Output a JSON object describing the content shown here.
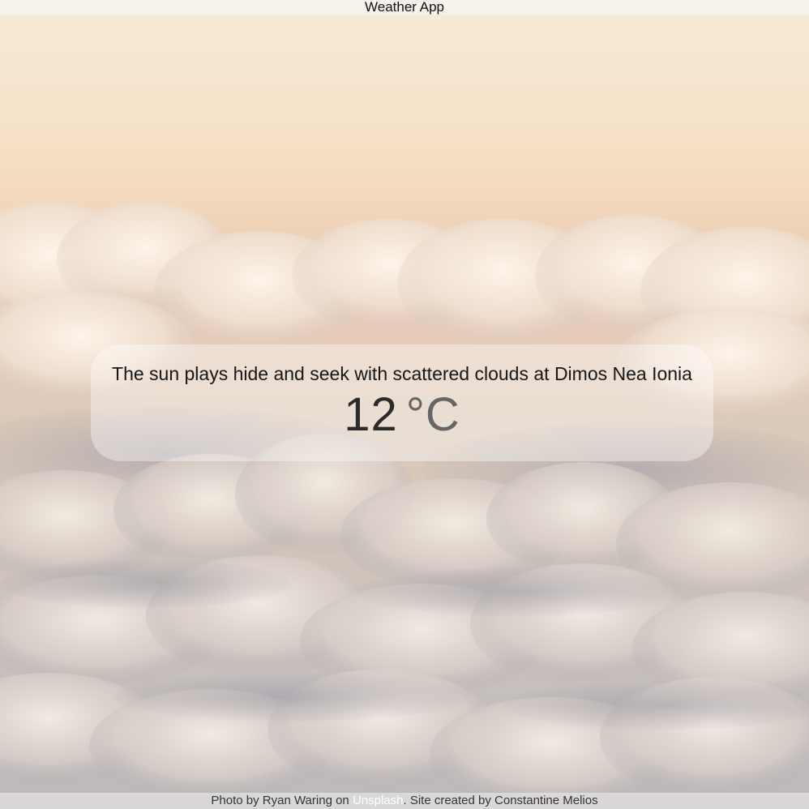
{
  "header": {
    "title": "Weather App"
  },
  "weather": {
    "description": "The sun plays hide and seek with scattered clouds at Dimos Nea Ionia",
    "temperature_value": "12",
    "temperature_unit": "°C"
  },
  "footer": {
    "prefix": "Photo by",
    "photographer": "Ryan Waring",
    "on_text": "on",
    "source": "Unsplash",
    "suffix": ". Site created by Constantine Melios"
  },
  "colors": {
    "link": "#ffffff",
    "card_background": "rgba(255,255,255,0.38)",
    "sky_top": "#f7ebd7",
    "sky_bottom": "#bdb9bb"
  }
}
